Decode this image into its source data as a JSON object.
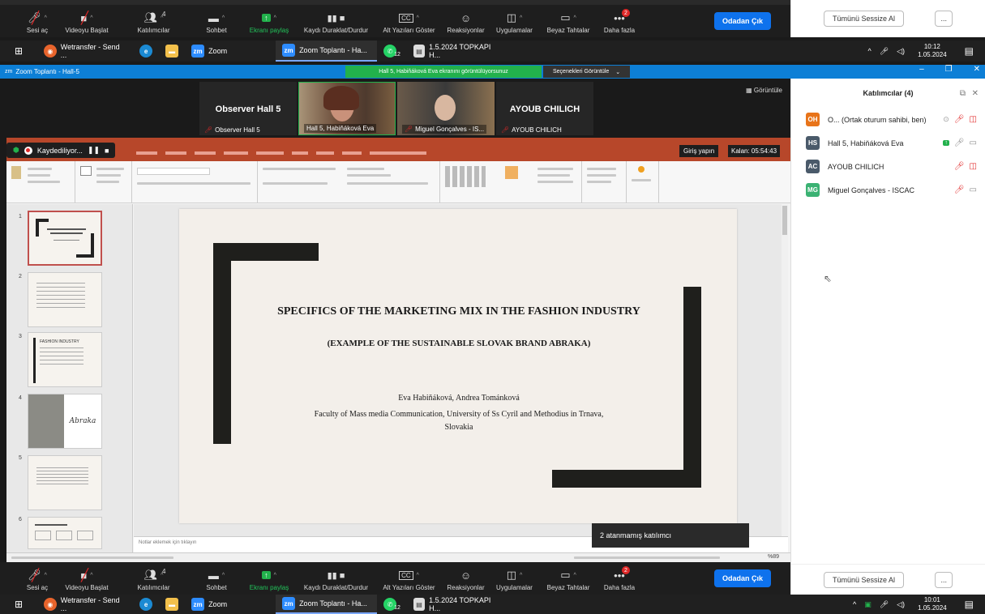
{
  "top_toolbar": {
    "mute": "Sesi aç",
    "video": "Videoyu Başlat",
    "participants": "Katılımcılar",
    "participants_count": "4",
    "chat": "Sohbet",
    "share": "Ekranı paylaş",
    "record": "Kaydı Duraklat/Durdur",
    "captions": "Alt Yazıları Göster",
    "reactions": "Reaksiyonlar",
    "apps": "Uygulamalar",
    "whiteboard": "Beyaz Tahtalar",
    "more": "Daha fazla",
    "more_badge": "2",
    "leave": "Odadan Çık"
  },
  "taskbar_top": {
    "items": [
      "Wetransfer - Send ...",
      "",
      "",
      "Zoom",
      "Zoom Toplantı - Ha...",
      "",
      "1.5.2024 TOPKAPI H..."
    ],
    "whatsapp_badge": "12",
    "time": "10:12",
    "date": "1.05.2024"
  },
  "taskbar_bottom": {
    "items": [
      "Wetransfer - Send ...",
      "",
      "",
      "Zoom",
      "Zoom Toplantı - Ha...",
      "",
      "1.5.2024 TOPKAPI H..."
    ],
    "whatsapp_badge": "12",
    "time": "10:01",
    "date": "1.05.2024"
  },
  "meeting_window": {
    "title": "Zoom Toplantı - Hall-5",
    "share_banner": "Hall 5, Habiňáková Eva ekranını görüntülüyorsunuz",
    "view_options": "Seçenekleri Görüntüle",
    "view_button": "Görüntüle",
    "recording": "Kaydediliyor...",
    "signin": "Giriş yapın",
    "time_left": "Kalan: 05:54:43",
    "unassigned": "2 atanmamış katılımcı"
  },
  "video_tiles": [
    {
      "label": "Observer Hall 5",
      "name": "Observer Hall 5",
      "type": "name"
    },
    {
      "label": "",
      "name": "Hall 5, Habiňáková Eva",
      "type": "video"
    },
    {
      "label": "",
      "name": "Miguel Gonçalves - IS...",
      "type": "video"
    },
    {
      "label": "AYOUB CHILICH",
      "name": "AYOUB CHILICH",
      "type": "name"
    }
  ],
  "ppt": {
    "signin_label": "Giriş yapın",
    "notes_placeholder": "Notlar eklemek için tıklayın",
    "slide_title": "SPECIFICS OF THE MARKETING MIX IN THE FASHION INDUSTRY",
    "slide_subtitle": "(EXAMPLE OF THE SUSTAINABLE SLOVAK BRAND ABRAKA)",
    "authors": "Eva Habiňáková, Andrea Tománková",
    "affiliation": "Faculty of Mass media Communication, University of Ss Cyril and Methodius in Trnava, Slovakia",
    "thumb_numbers": [
      "1",
      "2",
      "3",
      "4",
      "5",
      "6"
    ],
    "thumb3_title": "FASHION INDUSTRY",
    "thumb4_brand": "Abraka",
    "zoom_label": "%89"
  },
  "participants_panel": {
    "title": "Katılımcılar (4)",
    "mute_all": "Tümünü Sessize Al",
    "more": "...",
    "list": [
      {
        "initials": "OH",
        "color": "#e8741a",
        "name": "O... (Ortak oturum sahibi, ben)"
      },
      {
        "initials": "HS",
        "color": "#4a5a6a",
        "name": "Hall 5, Habiňáková Eva"
      },
      {
        "initials": "AC",
        "color": "#4a5a6a",
        "name": "AYOUB CHILICH"
      },
      {
        "initials": "MG",
        "color": "#3bb273",
        "name": "Miguel Gonçalves - ISCAC"
      }
    ]
  }
}
